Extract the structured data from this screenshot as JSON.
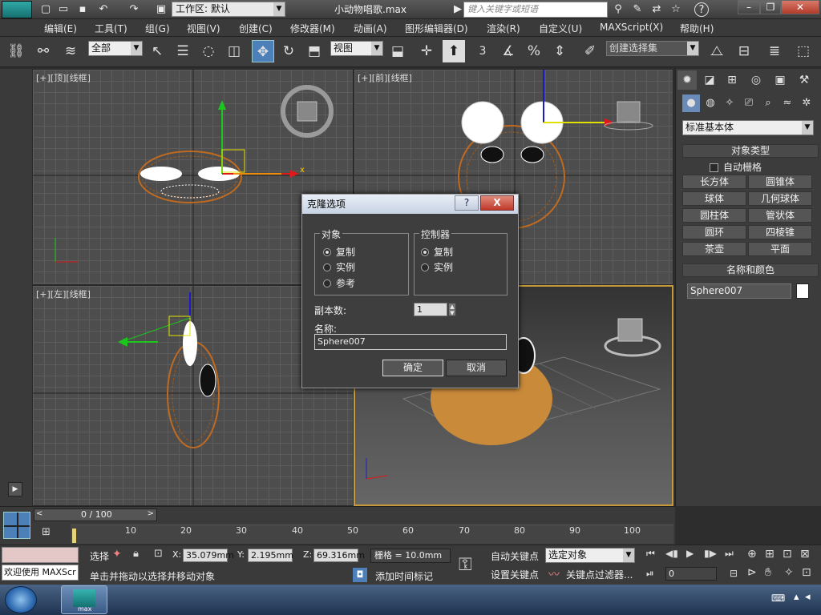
{
  "titlebar": {
    "workspace_label": "工作区: 默认",
    "file_title": "小动物唱歌.max",
    "search_placeholder": "键入关键字或短语"
  },
  "menus": [
    "编辑(E)",
    "工具(T)",
    "组(G)",
    "视图(V)",
    "创建(C)",
    "修改器(M)",
    "动画(A)",
    "图形编辑器(D)",
    "渲染(R)",
    "自定义(U)",
    "MAXScript(X)",
    "帮助(H)"
  ],
  "toolbar": {
    "filter_combo": "全部",
    "refcoord_combo": "视图",
    "snap_3": "3",
    "percent": "%",
    "named_selection": "创建选择集"
  },
  "viewports": {
    "top": "[+][顶][线框]",
    "front": "[+][前][线框]",
    "left": "[+][左][线框]",
    "axis_x": "x"
  },
  "command_panel": {
    "category_combo": "标准基本体",
    "rollout_object_type": "对象类型",
    "autogrid_label": "自动栅格",
    "objects": [
      "长方体",
      "圆锥体",
      "球体",
      "几何球体",
      "圆柱体",
      "管状体",
      "圆环",
      "四棱锥",
      "茶壶",
      "平面"
    ],
    "rollout_name_color": "名称和颜色",
    "object_name": "Sphere007",
    "object_color": "#ffffff"
  },
  "dialog": {
    "title": "克隆选项",
    "help_btn": "?",
    "close_btn": "X",
    "group_object": "对象",
    "object_options": [
      "复制",
      "实例",
      "参考"
    ],
    "group_controller": "控制器",
    "controller_options": [
      "复制",
      "实例"
    ],
    "copies_label": "副本数:",
    "copies_value": "1",
    "name_label": "名称:",
    "name_value": "Sphere007",
    "ok": "确定",
    "cancel": "取消"
  },
  "timeline": {
    "frame_display": "0 / 100",
    "ticks": [
      "10",
      "20",
      "30",
      "40",
      "50",
      "60",
      "70",
      "80",
      "90",
      "100"
    ]
  },
  "status": {
    "welcome": "欢迎使用 MAXScr",
    "sel_label": "选择",
    "x_label": "X:",
    "x_value": "35.079mm",
    "y_label": "Y:",
    "y_value": "2.195mm",
    "z_label": "Z:",
    "z_value": "69.316mm",
    "grid": "栅格 = 10.0mm",
    "prompt": "单击并拖动以选择并移动对象",
    "add_time_tag": "添加时间标记",
    "auto_key": "自动关键点",
    "set_key": "设置关键点",
    "selected_combo": "选定对象",
    "key_filters": "关键点过滤器...",
    "frame_field": "0"
  },
  "taskbar": {
    "app_label": "max"
  }
}
